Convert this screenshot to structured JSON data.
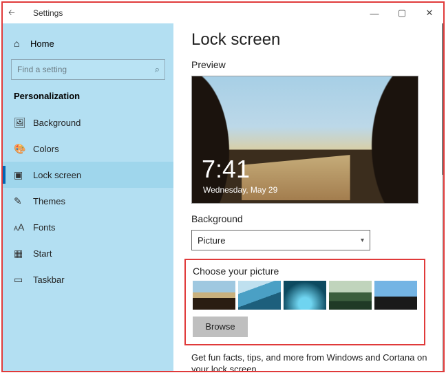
{
  "titlebar": {
    "app_title": "Settings"
  },
  "sidebar": {
    "home_label": "Home",
    "search_placeholder": "Find a setting",
    "section_label": "Personalization",
    "items": [
      {
        "label": "Background"
      },
      {
        "label": "Colors"
      },
      {
        "label": "Lock screen"
      },
      {
        "label": "Themes"
      },
      {
        "label": "Fonts"
      },
      {
        "label": "Start"
      },
      {
        "label": "Taskbar"
      }
    ]
  },
  "content": {
    "heading": "Lock screen",
    "preview_label": "Preview",
    "clock_time": "7:41",
    "clock_date": "Wednesday, May 29",
    "background_label": "Background",
    "background_value": "Picture",
    "choose_label": "Choose your picture",
    "browse_label": "Browse",
    "tip_text": "Get fun facts, tips, and more from Windows and Cortana on your lock screen"
  }
}
